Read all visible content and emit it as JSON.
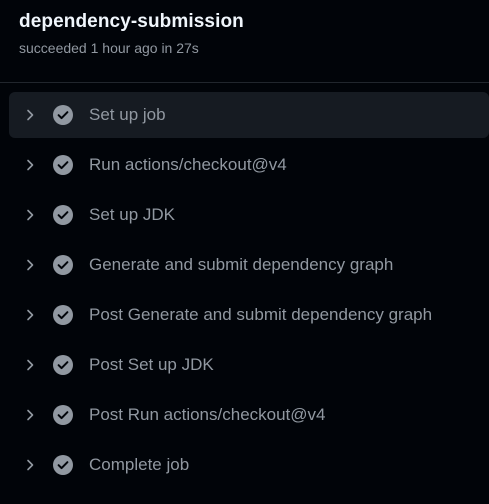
{
  "job": {
    "title": "dependency-submission",
    "status": "succeeded 1 hour ago in 27s"
  },
  "icons": {
    "expand": "chevron-right-icon",
    "status": "check-circle-fill-icon"
  },
  "colors": {
    "background": "#010409",
    "active_row": "#161b22",
    "title": "#f0f6fc",
    "muted": "#9198a1",
    "check_fill": "#9198a1",
    "divider": "#21262d"
  },
  "steps": [
    {
      "label": "Set up job"
    },
    {
      "label": "Run actions/checkout@v4"
    },
    {
      "label": "Set up JDK"
    },
    {
      "label": "Generate and submit dependency graph"
    },
    {
      "label": "Post Generate and submit dependency graph"
    },
    {
      "label": "Post Set up JDK"
    },
    {
      "label": "Post Run actions/checkout@v4"
    },
    {
      "label": "Complete job"
    }
  ]
}
